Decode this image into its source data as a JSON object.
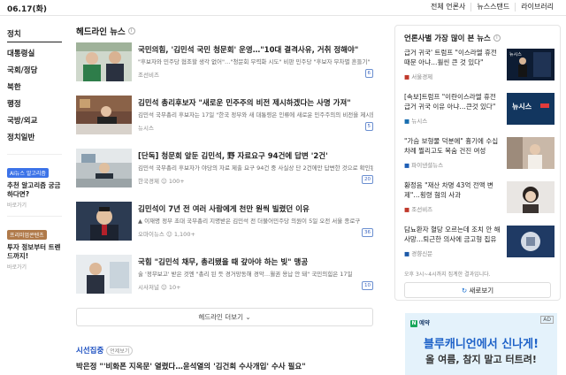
{
  "header": {
    "date": "06.17(화)",
    "links": [
      "전체 언론사",
      "뉴스스탠드",
      "라이브러리"
    ]
  },
  "nav": {
    "items": [
      "정치",
      "대통령실",
      "국회/정당",
      "북한",
      "행정",
      "국방/외교",
      "정치일반"
    ],
    "promos": [
      {
        "tag": "AI뉴스 알고리즘",
        "tag_color": "#3c73e8",
        "title": "추천 알고리즘 궁금하다면?",
        "sub": "바로가기"
      },
      {
        "tag": "프리미엄콘텐츠",
        "tag_color": "#b07a4a",
        "title": "투자 정보부터 트렌드까지!",
        "sub": "바로가기"
      }
    ]
  },
  "headline": {
    "title": "헤드라인 뉴스",
    "items": [
      {
        "title": "국민의힘, '김민석 국민 청문회' 운영…\"10대 결격사유, 거취 정해야\"",
        "desc": "\"후보자와 민주당 협조할 생각 없어\"…\"청문회 무력화 시도\" 비판 민주당 \"후보자 무차별 흔들기\"",
        "source": "조선비즈",
        "count": "6"
      },
      {
        "title": "김민석 총리후보자 \"새로운 민주주의 비전 제시하겠다는 사명 가져\"",
        "desc": "김민석 국무총리 후보자는 17일 \"한국 정부와 새 대통령은 인류에 새로운 민주주의의 비전을 제시할 것\"",
        "source": "뉴시스",
        "count": "5"
      },
      {
        "title": "[단독] 청문회 앞둔 김민석, 野 자료요구 94건에 답변 '2건'",
        "desc": "김민석 국무총리 후보자가 야당의 자료 제출 요구 94건 중 사실상 단 2건에만 답변한 것으로 확인됐다",
        "source": "한국경제",
        "reactions": "100+",
        "count": "20"
      },
      {
        "title": "김민석이 7년 전 여러 사람에게 천만 원씩 빌렸던 이유",
        "desc": "▲ 이재명 정부 초대 국무총리 지명받은 김민석 전 더불어민주당 의원이 5일 오전 서울 종로구",
        "source": "오마이뉴스",
        "reactions": "1,100+",
        "count": "36"
      },
      {
        "title": "국힘 \"김민석 채무, 총리됐을 때 갚아야 하는 빚\" 맹공",
        "desc": "술 '정무보고' 받은 것엔 \"총리 된 듯 경거망동해 경악…월권 용납 안 돼\" 국민의힘은 17일",
        "source": "시사저널",
        "reactions": "10+",
        "count": "10"
      }
    ],
    "more": "헤드라인 더보기"
  },
  "focus": {
    "title": "시선집중",
    "badge": "언제보기",
    "news": "박은정 \"'비화폰 지옥문' 열렸다…윤석열의 '김건희 수사개입' 수사 필요\""
  },
  "side": {
    "title": "언론사별 가장 많이 본 뉴스",
    "items": [
      {
        "title": "급거 귀국' 트럼프 \"이스라엘 휴전 때문 아냐…훨씬 큰 것 있다\"",
        "source": "서울경제",
        "thumb_text": "뉴시스"
      },
      {
        "title": "[속보]트럼프 \"이란이스라엘 휴전 급거 귀국 이유 아냐…큰것 있다\"",
        "source": "뉴시스",
        "thumb_text": "뉴시스"
      },
      {
        "title": "\"가슴 보형물 덕분에\" 흉기에 수십 차례 찔리고도 목숨 건진 여성",
        "source": "파이낸셜뉴스",
        "thumb_text": ""
      },
      {
        "title": "황정음 \"재산 차명 43억 전액 변제\"…횡령 혐의 사과",
        "source": "조선비즈",
        "thumb_text": ""
      },
      {
        "title": "담뇨환자 혈당 오르는데 조치 안 해 사망…퇴근한 의사에 금고형 집유",
        "source": "경향신문",
        "thumb_text": ""
      }
    ],
    "note": "오후 3시~4시까지 집계한 결과입니다.",
    "more": "새로보기"
  },
  "ad": {
    "tag": "AD",
    "brand": "예약",
    "headline": "블루캐니언에서 신나게!",
    "sub": "올 여름, 참지 말고 터트려!"
  }
}
